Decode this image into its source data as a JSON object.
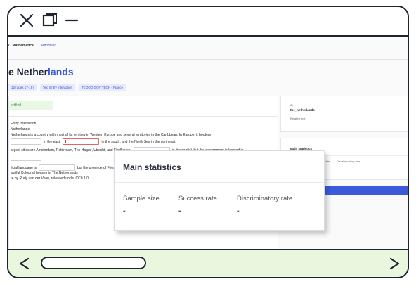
{
  "breadcrumb": {
    "items": [
      "/",
      "Mathematics",
      "/",
      "Arithmetic"
    ]
  },
  "page": {
    "title_part1": "e Nether",
    "title_part2": "lands",
    "tags": [
      "12 (ages 17-18)",
      "Text Entry Interaction",
      "TEOOO GOV TECH - France"
    ]
  },
  "exercise": {
    "badge": "ertified",
    "line1": "Entry Interaction",
    "line2": "Netherlands",
    "line3": "Netherlands is a country with most of its territory in Western Europe and several territories in the Caribbean. In Europe, it borders",
    "line4_a": "in the east,",
    "line4_b": "in the south, and the North Sea in the northeast.",
    "line5_a": "argest cities are Amsterdam, Rotterdam, The Hague, Utrecht, and Eindhoven.",
    "line5_b": "is the capital, but the government is located in",
    "line6_a": ".",
    "line7_a": "ficial language is",
    "line7_b": "but the province of Friesland has a secondary language, West Frisian.",
    "line8": "autiful Colourful houses in The Netherlands",
    "line9": "re by Rudy van der Veen, released under CC0 1.0."
  },
  "id_card": {
    "id_label": "ID",
    "id_value": "the_netherlands",
    "related_label": "Related text",
    "related_value": "-"
  },
  "small_stats": {
    "title": "Main statistics",
    "labels": [
      "Sample size",
      "Success rate",
      "Discriminatory rate"
    ],
    "values": [
      "-",
      "-",
      "-"
    ]
  },
  "main_stats": {
    "title": "Main statistics",
    "sample_size_label": "Sample size",
    "success_rate_label": "Success rate",
    "discriminatory_rate_label": "Discriminatory rate",
    "sample_size_value": "-",
    "success_rate_value": "-",
    "discriminatory_rate_value": "-"
  },
  "colors": {
    "accent": "#3b5bdb",
    "frame": "#1f2433",
    "bottom_bar": "#eaf6de",
    "certified_bg": "#e9f8e4",
    "active_blank": "#e0656b"
  },
  "icons": {
    "close": "close-icon",
    "maximize": "maximize-icon",
    "minimize": "minimize-icon",
    "back": "chevron-left-icon",
    "forward": "chevron-right-icon"
  }
}
